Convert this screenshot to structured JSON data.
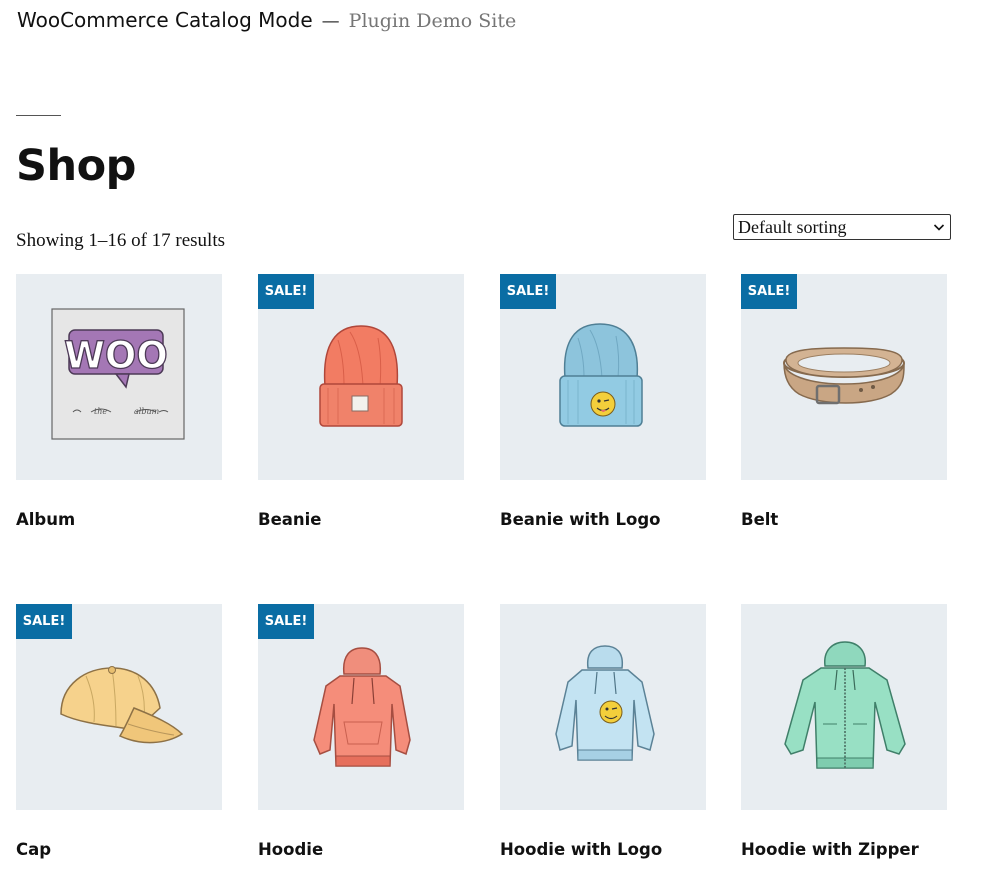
{
  "site": {
    "title": "WooCommerce Catalog Mode",
    "separator": "—",
    "description": "Plugin Demo Site"
  },
  "page": {
    "title": "Shop",
    "result_count": "Showing 1–16 of 17 results"
  },
  "ordering": {
    "selected": "Default sorting"
  },
  "sale_badge_label": "SALE!",
  "colors": {
    "sale_badge": "#0a6da4",
    "thumbnail_bg": "#e8edf1"
  },
  "products": [
    {
      "name": "Album",
      "on_sale": false,
      "icon": "album-icon"
    },
    {
      "name": "Beanie",
      "on_sale": true,
      "icon": "beanie-icon"
    },
    {
      "name": "Beanie with Logo",
      "on_sale": true,
      "icon": "beanie-logo-icon"
    },
    {
      "name": "Belt",
      "on_sale": true,
      "icon": "belt-icon"
    },
    {
      "name": "Cap",
      "on_sale": true,
      "icon": "cap-icon"
    },
    {
      "name": "Hoodie",
      "on_sale": true,
      "icon": "hoodie-icon"
    },
    {
      "name": "Hoodie with Logo",
      "on_sale": false,
      "icon": "hoodie-logo-icon"
    },
    {
      "name": "Hoodie with Zipper",
      "on_sale": false,
      "icon": "hoodie-zipper-icon"
    }
  ]
}
